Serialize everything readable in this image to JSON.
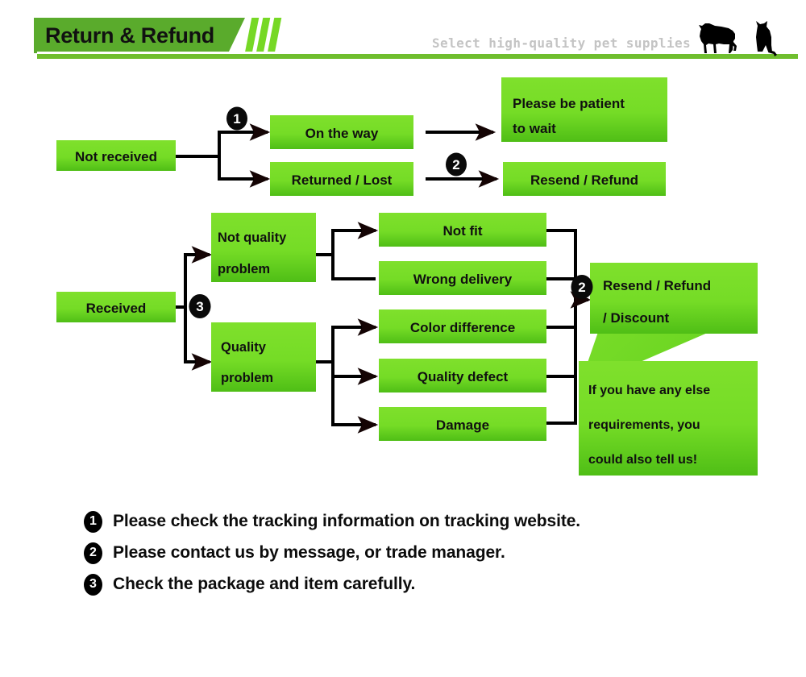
{
  "header": {
    "title": "Return & Refund",
    "tagline": "Select high-quality pet supplies",
    "accent_green": "#5aab2c",
    "stripe_green": "#76d825",
    "rule_green": "#6fbe2e",
    "tagline_color": "#c4c4c4",
    "icons": [
      "dog-silhouette",
      "cat-silhouette"
    ]
  },
  "flow": {
    "box_green_top": "#7ee02a",
    "box_green_bottom": "#56c41c",
    "connector_color": "#000000",
    "nodes": {
      "not_received": "Not received",
      "on_the_way": "On the way",
      "returned_lost": "Returned / Lost",
      "please_be_patient_1": "Please be patient",
      "please_be_patient_2": "to wait",
      "resend_refund": "Resend / Refund",
      "received": "Received",
      "not_quality_1": "Not quality",
      "not_quality_2": "problem",
      "quality_1": "Quality",
      "quality_2": "problem",
      "not_fit": "Not fit",
      "wrong_delivery": "Wrong delivery",
      "color_difference": "Color difference",
      "quality_defect": "Quality defect",
      "damage": "Damage",
      "resend_refund_discount_1": "Resend / Refund",
      "resend_refund_discount_2": "/ Discount",
      "callout_1": "If you have any else",
      "callout_2": "requirements, you",
      "callout_3": "could also tell us!"
    },
    "markers": {
      "m1": "1",
      "m2a": "2",
      "m2b": "2",
      "m3": "3"
    }
  },
  "notes": [
    {
      "num": "1",
      "text": "Please check the tracking information on tracking website."
    },
    {
      "num": "2",
      "text": "Please contact us by message, or trade manager."
    },
    {
      "num": "3",
      "text": "Check the package and item carefully."
    }
  ]
}
